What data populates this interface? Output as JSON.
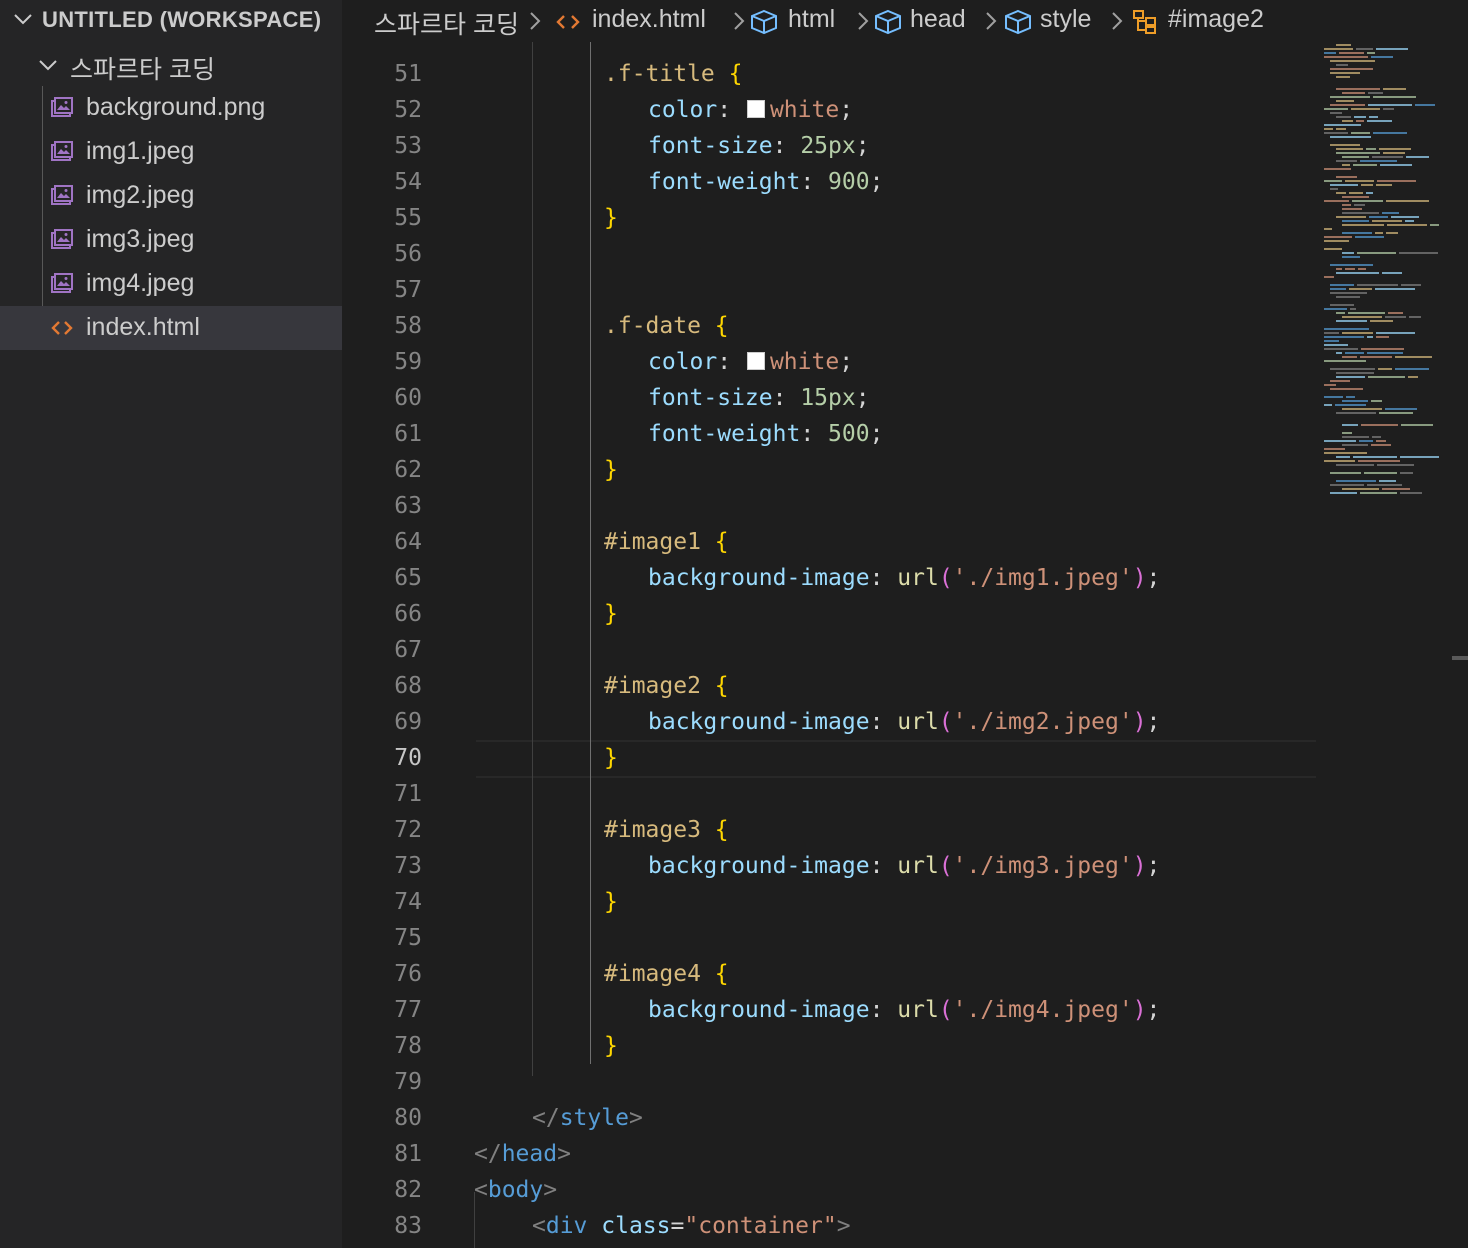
{
  "sidebar": {
    "workspace_title": "UNTITLED (WORKSPACE)",
    "folder_name": "스파르타 코딩",
    "files": [
      {
        "name": "background.png",
        "icon": "image-file-icon",
        "selected": false
      },
      {
        "name": "img1.jpeg",
        "icon": "image-file-icon",
        "selected": false
      },
      {
        "name": "img2.jpeg",
        "icon": "image-file-icon",
        "selected": false
      },
      {
        "name": "img3.jpeg",
        "icon": "image-file-icon",
        "selected": false
      },
      {
        "name": "img4.jpeg",
        "icon": "image-file-icon",
        "selected": false
      },
      {
        "name": "index.html",
        "icon": "html-file-icon",
        "selected": true
      }
    ]
  },
  "breadcrumb": {
    "items": [
      {
        "label": "스파르타 코딩",
        "icon": ""
      },
      {
        "label": "index.html",
        "icon": "html-file-icon"
      },
      {
        "label": "html",
        "icon": "cube-icon"
      },
      {
        "label": "head",
        "icon": "cube-icon"
      },
      {
        "label": "style",
        "icon": "cube-icon"
      },
      {
        "label": "#image2",
        "icon": "css-selector-icon"
      }
    ]
  },
  "editor": {
    "active_line": 70,
    "lines": [
      {
        "n": "51",
        "tokens": [
          [
            "tk-sel",
            ".f-title"
          ],
          [
            "tk-plain",
            " "
          ],
          [
            "tk-brace",
            "{"
          ]
        ]
      },
      {
        "n": "52",
        "tokens": [
          [
            "tk-prop",
            "color"
          ],
          [
            "tk-plain",
            ": "
          ],
          [
            "swatch",
            ""
          ],
          [
            "tk-str",
            "white"
          ],
          [
            "tk-plain",
            ";"
          ]
        ]
      },
      {
        "n": "53",
        "tokens": [
          [
            "tk-prop",
            "font-size"
          ],
          [
            "tk-plain",
            ": "
          ],
          [
            "tk-num",
            "25px"
          ],
          [
            "tk-plain",
            ";"
          ]
        ]
      },
      {
        "n": "54",
        "tokens": [
          [
            "tk-prop",
            "font-weight"
          ],
          [
            "tk-plain",
            ": "
          ],
          [
            "tk-num",
            "900"
          ],
          [
            "tk-plain",
            ";"
          ]
        ]
      },
      {
        "n": "55",
        "tokens": [
          [
            "tk-brace",
            "}"
          ]
        ]
      },
      {
        "n": "56",
        "tokens": []
      },
      {
        "n": "57",
        "tokens": []
      },
      {
        "n": "58",
        "tokens": [
          [
            "tk-sel",
            ".f-date"
          ],
          [
            "tk-plain",
            " "
          ],
          [
            "tk-brace",
            "{"
          ]
        ]
      },
      {
        "n": "59",
        "tokens": [
          [
            "tk-prop",
            "color"
          ],
          [
            "tk-plain",
            ": "
          ],
          [
            "swatch",
            ""
          ],
          [
            "tk-str",
            "white"
          ],
          [
            "tk-plain",
            ";"
          ]
        ]
      },
      {
        "n": "60",
        "tokens": [
          [
            "tk-prop",
            "font-size"
          ],
          [
            "tk-plain",
            ": "
          ],
          [
            "tk-num",
            "15px"
          ],
          [
            "tk-plain",
            ";"
          ]
        ]
      },
      {
        "n": "61",
        "tokens": [
          [
            "tk-prop",
            "font-weight"
          ],
          [
            "tk-plain",
            ": "
          ],
          [
            "tk-num",
            "500"
          ],
          [
            "tk-plain",
            ";"
          ]
        ]
      },
      {
        "n": "62",
        "tokens": [
          [
            "tk-brace",
            "}"
          ]
        ]
      },
      {
        "n": "63",
        "tokens": []
      },
      {
        "n": "64",
        "tokens": [
          [
            "tk-sel",
            "#image1"
          ],
          [
            "tk-plain",
            " "
          ],
          [
            "tk-brace",
            "{"
          ]
        ]
      },
      {
        "n": "65",
        "tokens": [
          [
            "tk-prop",
            "background-image"
          ],
          [
            "tk-plain",
            ": "
          ],
          [
            "tk-fn",
            "url"
          ],
          [
            "tk-paren",
            "("
          ],
          [
            "tk-str",
            "'./img1.jpeg'"
          ],
          [
            "tk-paren",
            ")"
          ],
          [
            "tk-plain",
            ";"
          ]
        ]
      },
      {
        "n": "66",
        "tokens": [
          [
            "tk-brace",
            "}"
          ]
        ]
      },
      {
        "n": "67",
        "tokens": []
      },
      {
        "n": "68",
        "tokens": [
          [
            "tk-sel",
            "#image2"
          ],
          [
            "tk-plain",
            " "
          ],
          [
            "tk-brace",
            "{"
          ]
        ]
      },
      {
        "n": "69",
        "tokens": [
          [
            "tk-prop",
            "background-image"
          ],
          [
            "tk-plain",
            ": "
          ],
          [
            "tk-fn",
            "url"
          ],
          [
            "tk-paren",
            "("
          ],
          [
            "tk-str",
            "'./img2.jpeg'"
          ],
          [
            "tk-paren",
            ")"
          ],
          [
            "tk-plain",
            ";"
          ]
        ]
      },
      {
        "n": "70",
        "tokens": [
          [
            "tk-brace",
            "}"
          ]
        ]
      },
      {
        "n": "71",
        "tokens": []
      },
      {
        "n": "72",
        "tokens": [
          [
            "tk-sel",
            "#image3"
          ],
          [
            "tk-plain",
            " "
          ],
          [
            "tk-brace",
            "{"
          ]
        ]
      },
      {
        "n": "73",
        "tokens": [
          [
            "tk-prop",
            "background-image"
          ],
          [
            "tk-plain",
            ": "
          ],
          [
            "tk-fn",
            "url"
          ],
          [
            "tk-paren",
            "("
          ],
          [
            "tk-str",
            "'./img3.jpeg'"
          ],
          [
            "tk-paren",
            ")"
          ],
          [
            "tk-plain",
            ";"
          ]
        ]
      },
      {
        "n": "74",
        "tokens": [
          [
            "tk-brace",
            "}"
          ]
        ]
      },
      {
        "n": "75",
        "tokens": []
      },
      {
        "n": "76",
        "tokens": [
          [
            "tk-sel",
            "#image4"
          ],
          [
            "tk-plain",
            " "
          ],
          [
            "tk-brace",
            "{"
          ]
        ]
      },
      {
        "n": "77",
        "tokens": [
          [
            "tk-prop",
            "background-image"
          ],
          [
            "tk-plain",
            ": "
          ],
          [
            "tk-fn",
            "url"
          ],
          [
            "tk-paren",
            "("
          ],
          [
            "tk-str",
            "'./img4.jpeg'"
          ],
          [
            "tk-paren",
            ")"
          ],
          [
            "tk-plain",
            ";"
          ]
        ]
      },
      {
        "n": "78",
        "tokens": [
          [
            "tk-brace",
            "}"
          ]
        ]
      },
      {
        "n": "79",
        "tokens": []
      },
      {
        "n": "80",
        "tokens": [
          [
            "tk-punct",
            "</"
          ],
          [
            "tk-tag",
            "style"
          ],
          [
            "tk-punct",
            ">"
          ]
        ]
      },
      {
        "n": "81",
        "tokens": [
          [
            "tk-punct",
            "</"
          ],
          [
            "tk-tag",
            "head"
          ],
          [
            "tk-punct",
            ">"
          ]
        ]
      },
      {
        "n": "82",
        "tokens": [
          [
            "tk-punct",
            "<"
          ],
          [
            "tk-tag",
            "body"
          ],
          [
            "tk-punct",
            ">"
          ]
        ]
      },
      {
        "n": "83",
        "tokens": [
          [
            "tk-punct",
            "<"
          ],
          [
            "tk-tag",
            "div"
          ],
          [
            "tk-plain",
            " "
          ],
          [
            "tk-prop",
            "class"
          ],
          [
            "tk-plain",
            "="
          ],
          [
            "tk-str",
            "\"container\""
          ],
          [
            "tk-punct",
            ">"
          ]
        ]
      }
    ]
  }
}
